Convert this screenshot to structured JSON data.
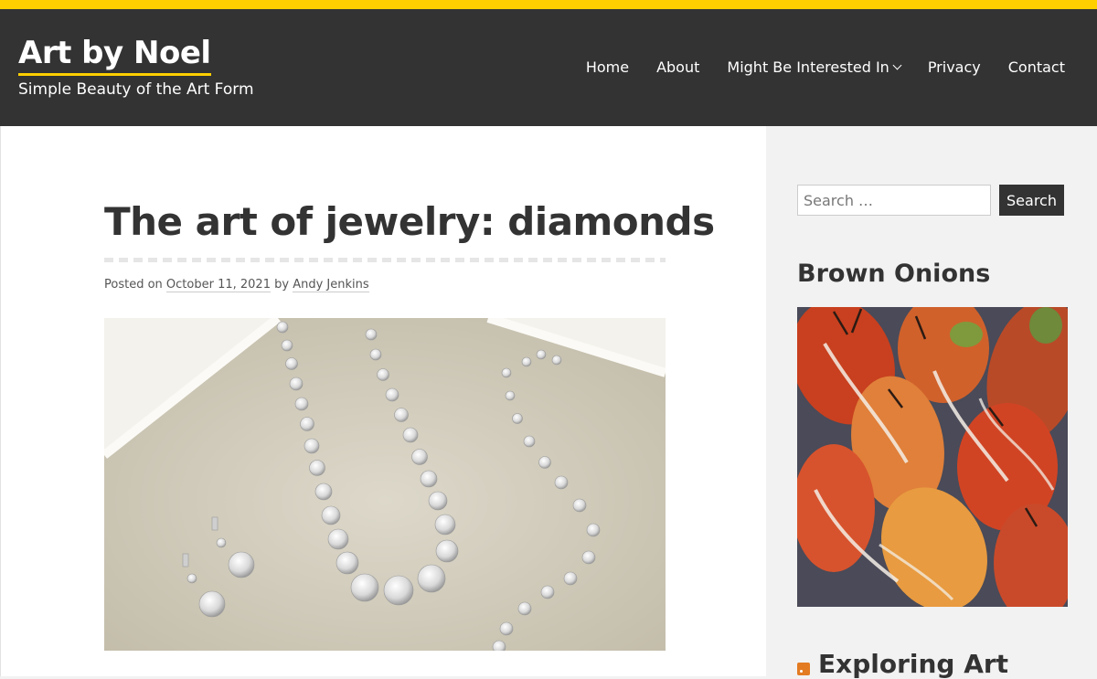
{
  "site": {
    "title": "Art by Noel",
    "tagline": "Simple Beauty of the Art Form"
  },
  "nav": {
    "items": [
      {
        "label": "Home"
      },
      {
        "label": "About"
      },
      {
        "label": "Might Be Interested In",
        "has_dropdown": true
      },
      {
        "label": "Privacy"
      },
      {
        "label": "Contact"
      }
    ]
  },
  "post": {
    "title": "The art of jewelry: diamonds",
    "meta": {
      "posted_on_label": "Posted on",
      "date": "October 11, 2021",
      "by_label": "by",
      "author": "Andy Jenkins"
    }
  },
  "sidebar": {
    "search": {
      "placeholder": "Search …",
      "button_label": "Search"
    },
    "widget1_title": "Brown Onions",
    "widget2_title": "Exploring Art"
  },
  "colors": {
    "accent": "#ffcf00",
    "header_bg": "#333333",
    "sidebar_bg": "#f2f2f2"
  }
}
